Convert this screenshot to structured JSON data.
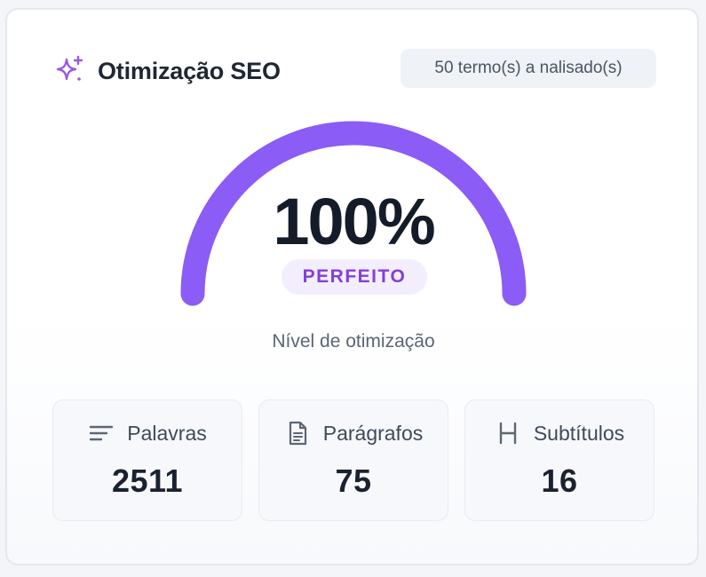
{
  "header": {
    "title": "Otimização SEO",
    "icon": "sparkles-icon",
    "terms_badge": "50 termo(s) a nalisado(s)"
  },
  "gauge": {
    "value_label": "100%",
    "level_percent": 100,
    "status": "PERFEITO",
    "caption": "Nível de otimização",
    "color": "#8b5cf6"
  },
  "stats": [
    {
      "icon": "lines-icon",
      "label": "Palavras",
      "value": "2511"
    },
    {
      "icon": "document-icon",
      "label": "Parágrafos",
      "value": "75"
    },
    {
      "icon": "heading-icon",
      "label": "Subtítulos",
      "value": "16"
    }
  ],
  "colors": {
    "accent": "#8b5cf6",
    "status_text": "#8240d8",
    "status_bg": "#f3eefe"
  }
}
